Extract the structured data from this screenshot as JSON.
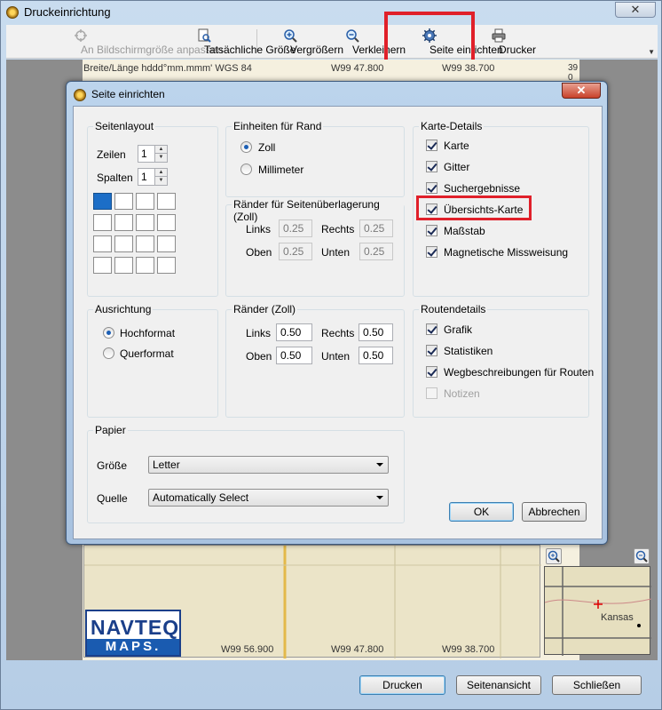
{
  "outer_window": {
    "title": "Druckeinrichtung",
    "close": "✕"
  },
  "toolbar": {
    "fit_screen": "An Bildschirmgröße anpassen",
    "actual_size": "Tatsächliche Größe",
    "zoom_in": "Vergrößern",
    "zoom_out": "Verkleinern",
    "page_setup": "Seite einrichten",
    "printer": "Drucker",
    "more": "▼"
  },
  "map": {
    "header_coord": "Breite/Länge hddd°mm.mmm' WGS 84",
    "top_coord_1": "W99 47.800",
    "top_coord_2": "W99 38.700",
    "side_coord": "39 0",
    "bottom_coord_1": "W99 56.900",
    "bottom_coord_2": "W99 47.800",
    "bottom_coord_3": "W99 38.700",
    "logo_top": "NAVTEQ",
    "logo_bottom": "MAPS.",
    "overview_label": "Kansas"
  },
  "bottom_buttons": {
    "print": "Drucken",
    "preview": "Seitenansicht",
    "close": "Schließen"
  },
  "dialog": {
    "title": "Seite einrichten",
    "close": "✕",
    "page_layout": {
      "title": "Seitenlayout",
      "rows_label": "Zeilen",
      "rows_value": "1",
      "cols_label": "Spalten",
      "cols_value": "1"
    },
    "border_units": {
      "title": "Einheiten für Rand",
      "inch": "Zoll",
      "mm": "Millimeter",
      "selected": "Zoll"
    },
    "overlap": {
      "title": "Ränder für Seitenüberlagerung (Zoll)",
      "left_label": "Links",
      "left_value": "0.25",
      "right_label": "Rechts",
      "right_value": "0.25",
      "top_label": "Oben",
      "top_value": "0.25",
      "bottom_label": "Unten",
      "bottom_value": "0.25"
    },
    "map_details": {
      "title": "Karte-Details",
      "items": [
        {
          "label": "Karte",
          "checked": true
        },
        {
          "label": "Gitter",
          "checked": true
        },
        {
          "label": "Suchergebnisse",
          "checked": true
        },
        {
          "label": "Übersichts-Karte",
          "checked": true
        },
        {
          "label": "Maßstab",
          "checked": true
        },
        {
          "label": "Magnetische Missweisung",
          "checked": true
        }
      ]
    },
    "orientation": {
      "title": "Ausrichtung",
      "portrait": "Hochformat",
      "landscape": "Querformat",
      "selected": "Hochformat"
    },
    "margins": {
      "title": "Ränder (Zoll)",
      "left_label": "Links",
      "left_value": "0.50",
      "right_label": "Rechts",
      "right_value": "0.50",
      "top_label": "Oben",
      "top_value": "0.50",
      "bottom_label": "Unten",
      "bottom_value": "0.50"
    },
    "route_details": {
      "title": "Routendetails",
      "items": [
        {
          "label": "Grafik",
          "checked": true,
          "disabled": false
        },
        {
          "label": "Statistiken",
          "checked": true,
          "disabled": false
        },
        {
          "label": "Wegbeschreibungen für Routen",
          "checked": true,
          "disabled": false
        },
        {
          "label": "Notizen",
          "checked": false,
          "disabled": true
        }
      ]
    },
    "paper": {
      "title": "Papier",
      "size_label": "Größe",
      "size_value": "Letter",
      "source_label": "Quelle",
      "source_value": "Automatically Select"
    },
    "ok": "OK",
    "cancel": "Abbrechen"
  },
  "colors": {
    "highlight": "#e0202a",
    "selected_cell": "#1c6ec7"
  }
}
